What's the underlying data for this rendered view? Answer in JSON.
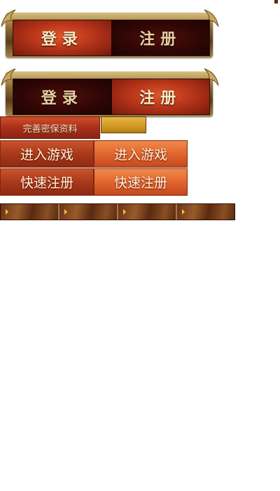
{
  "login_panel_1": {
    "tabs": [
      {
        "label": "登录",
        "state": "active"
      },
      {
        "label": "注册",
        "state": "inactive"
      }
    ]
  },
  "login_panel_2": {
    "tabs": [
      {
        "label": "登录",
        "state": "inactive"
      },
      {
        "label": "注册",
        "state": "active"
      }
    ]
  },
  "security": {
    "complete_label": "完善密保资料"
  },
  "game_buttons": {
    "enter_normal": "进入游戏",
    "enter_hover": "进入游戏",
    "register_normal": "快速注册",
    "register_hover": "快速注册"
  },
  "menu_strip": {
    "icon": "triangle-right-icon",
    "items": 4
  },
  "colors": {
    "active_tab": "#b8351a",
    "inactive_tab": "#2e0604",
    "frame_gold": "#b09050",
    "button_orange": "#e2652f",
    "gold_button": "#d49a25"
  }
}
